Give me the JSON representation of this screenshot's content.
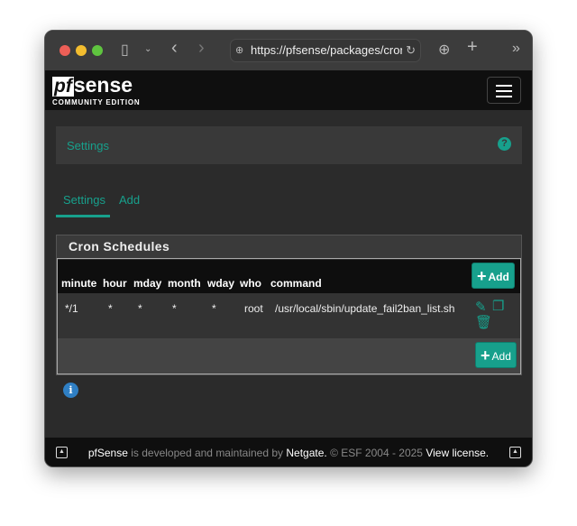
{
  "browser": {
    "url": "https://pfsense/packages/cron/"
  },
  "brand": {
    "logo_pf": "pf",
    "logo_sense": "sense",
    "edition": "COMMUNITY EDITION"
  },
  "breadcrumb": {
    "title": "Settings"
  },
  "tabs": [
    {
      "label": "Settings",
      "active": true
    },
    {
      "label": "Add",
      "active": false
    }
  ],
  "panel": {
    "title": "Cron Schedules",
    "columns": [
      "minute",
      "hour",
      "mday",
      "month",
      "wday",
      "who",
      "command"
    ],
    "rows": [
      {
        "minute": "*/1",
        "hour": "*",
        "mday": "*",
        "month": "*",
        "wday": "*",
        "who": "root",
        "command": "/usr/local/sbin/update_fail2ban_list.sh"
      }
    ],
    "add_label": "Add"
  },
  "footer": {
    "brand": "pfSense",
    "text1": " is developed and maintained by ",
    "company": "Netgate.",
    "text2": " © ESF 2004 - 2025 ",
    "license": "View license."
  },
  "colors": {
    "accent": "#17a08c",
    "info": "#2f7fc4"
  }
}
